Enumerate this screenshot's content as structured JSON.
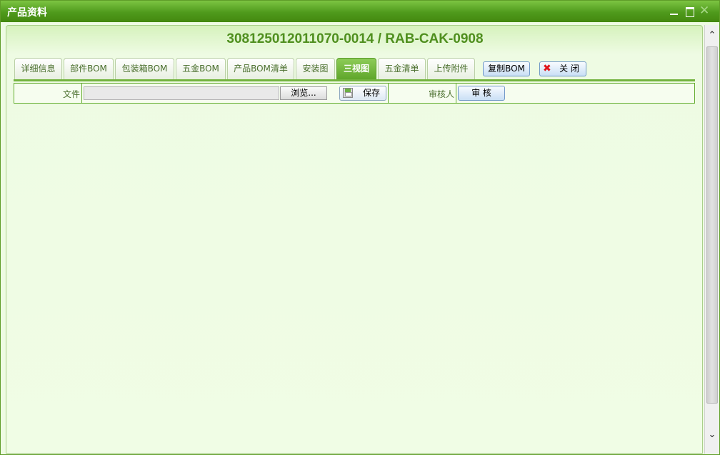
{
  "window": {
    "title": "产品资料"
  },
  "header": {
    "title": "308125012011070-0014 / RAB-CAK-0908"
  },
  "tabs": [
    {
      "label": "详细信息",
      "active": false
    },
    {
      "label": "部件BOM",
      "active": false
    },
    {
      "label": "包装箱BOM",
      "active": false
    },
    {
      "label": "五金BOM",
      "active": false
    },
    {
      "label": "产品BOM清单",
      "active": false
    },
    {
      "label": "安装图",
      "active": false
    },
    {
      "label": "三视图",
      "active": true
    },
    {
      "label": "五金清单",
      "active": false
    },
    {
      "label": "上传附件",
      "active": false
    }
  ],
  "toolbar": {
    "copy_bom_label": "复制BOM",
    "close_label": "关 闭"
  },
  "form": {
    "file_label": "文件",
    "file_value": "",
    "browse_label": "浏览...",
    "save_label": "保存",
    "reviewer_label": "审核人",
    "audit_label": "审 核"
  },
  "icons": {
    "minimize": "minimize-icon",
    "maximize": "maximize-icon",
    "close": "close-icon",
    "save": "save-disk-icon",
    "close_form": "red-x-icon"
  },
  "colors": {
    "titlebar": "#4f9a1c",
    "accent_green": "#73b33f",
    "headline": "#4f8f1e",
    "close_x": "#e0141a"
  }
}
